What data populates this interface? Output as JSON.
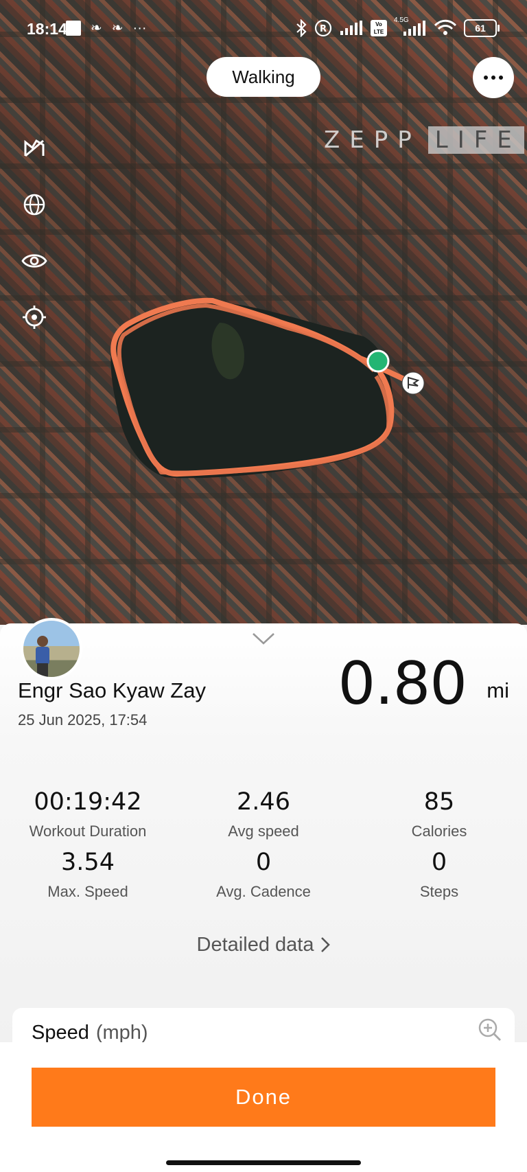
{
  "status_bar": {
    "time": "18:14",
    "battery": "61",
    "icons": [
      "square-icon",
      "app-icon",
      "app-icon",
      "more-dots-icon",
      "bluetooth-icon",
      "registered-icon",
      "signal-icon",
      "volte-icon",
      "4g-signal-icon",
      "wifi-icon",
      "battery-icon"
    ],
    "network_label": "4.5G",
    "volte_label": "Vo LTE"
  },
  "map": {
    "mode_label": "Walking",
    "watermark_left": "ZEPP",
    "watermark_right": "LIFE",
    "route_color": "#f07a50",
    "start_color": "#22b573",
    "tools": [
      "map-layers-icon",
      "globe-icon",
      "eye-icon",
      "locate-icon"
    ]
  },
  "workout": {
    "user_name": "Engr Sao Kyaw Zay",
    "date": "25 Jun 2025, 17:54",
    "distance": "0.80",
    "distance_unit": "mi",
    "stats": [
      {
        "value": "00:19:42",
        "label": "Workout Duration"
      },
      {
        "value": "2.46",
        "label": "Avg speed"
      },
      {
        "value": "85",
        "label": "Calories"
      },
      {
        "value": "3.54",
        "label": "Max. Speed"
      },
      {
        "value": "0",
        "label": "Avg. Cadence"
      },
      {
        "value": "0",
        "label": "Steps"
      }
    ],
    "detailed_label": "Detailed data",
    "speed_title": "Speed",
    "speed_unit": "(mph)"
  },
  "footer": {
    "done_label": "Done"
  },
  "colors": {
    "accent": "#ff7a1a"
  }
}
